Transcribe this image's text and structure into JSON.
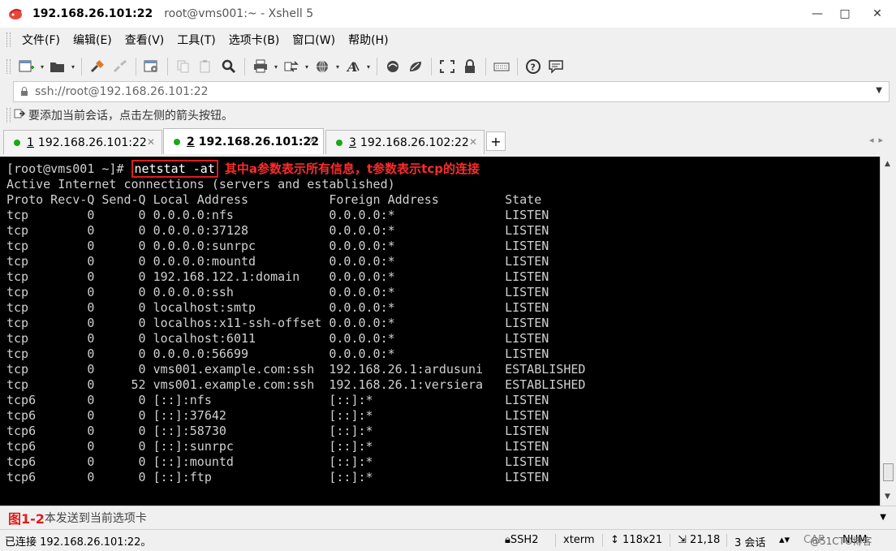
{
  "window": {
    "title_host": "192.168.26.101:22",
    "title_rest": "root@vms001:~ - Xshell 5",
    "minimize": "—",
    "maximize": "□",
    "close": "✕"
  },
  "menu": [
    "文件(F)",
    "编辑(E)",
    "查看(V)",
    "工具(T)",
    "选项卡(B)",
    "窗口(W)",
    "帮助(H)"
  ],
  "address": {
    "value": "ssh://root@192.168.26.101:22"
  },
  "hint": {
    "text": "要添加当前会话，点击左侧的箭头按钮。"
  },
  "tabs": [
    {
      "num": "1",
      "label": "192.168.26.101:22",
      "active": false
    },
    {
      "num": "2",
      "label": "192.168.26.101:22",
      "active": true
    },
    {
      "num": "3",
      "label": "192.168.26.102:22",
      "active": false
    }
  ],
  "tab_add": "+",
  "tab_nav": "◂▸",
  "terminal": {
    "prompt": "[root@vms001 ~]# ",
    "command": "netstat -at",
    "annotation": "其中a参数表示所有信息，t参数表示tcp的连接",
    "lines": [
      "Active Internet connections (servers and established)",
      "Proto Recv-Q Send-Q Local Address           Foreign Address         State",
      "tcp        0      0 0.0.0.0:nfs             0.0.0.0:*               LISTEN",
      "tcp        0      0 0.0.0.0:37128           0.0.0.0:*               LISTEN",
      "tcp        0      0 0.0.0.0:sunrpc          0.0.0.0:*               LISTEN",
      "tcp        0      0 0.0.0.0:mountd          0.0.0.0:*               LISTEN",
      "tcp        0      0 192.168.122.1:domain    0.0.0.0:*               LISTEN",
      "tcp        0      0 0.0.0.0:ssh             0.0.0.0:*               LISTEN",
      "tcp        0      0 localhost:smtp          0.0.0.0:*               LISTEN",
      "tcp        0      0 localhos:x11-ssh-offset 0.0.0.0:*               LISTEN",
      "tcp        0      0 localhost:6011          0.0.0.0:*               LISTEN",
      "tcp        0      0 0.0.0.0:56699           0.0.0.0:*               LISTEN",
      "tcp        0      0 vms001.example.com:ssh  192.168.26.1:ardusuni   ESTABLISHED",
      "tcp        0     52 vms001.example.com:ssh  192.168.26.1:versiera   ESTABLISHED",
      "tcp6       0      0 [::]:nfs                [::]:*                  LISTEN",
      "tcp6       0      0 [::]:37642              [::]:*                  LISTEN",
      "tcp6       0      0 [::]:58730              [::]:*                  LISTEN",
      "tcp6       0      0 [::]:sunrpc             [::]:*                  LISTEN",
      "tcp6       0      0 [::]:mountd             [::]:*                  LISTEN",
      "tcp6       0      0 [::]:ftp                [::]:*                  LISTEN"
    ]
  },
  "inputbar": {
    "fig_label": "图1-2",
    "placeholder": "本发送到当前选项卡"
  },
  "status": {
    "connection": "已连接 192.168.26.101:22。",
    "protocol": "SSH2",
    "terminal_type": "xterm",
    "size": "118x21",
    "cursor": "21,18",
    "sessions": "3 会话",
    "caps": "CAP",
    "num": "NUM",
    "watermark": "@51CTO博客"
  }
}
